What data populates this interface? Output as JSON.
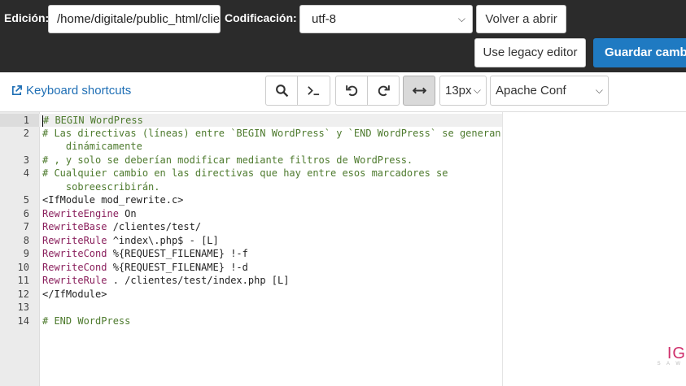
{
  "header": {
    "edit_label": "Edición:",
    "path_value": "/home/digitale/public_html/clientes/test/.htaccess",
    "encoding_label": "Codificación:",
    "encoding_value": "utf-8",
    "reopen_label": "Volver a abrir",
    "legacy_label": "Use legacy editor",
    "save_label": "Guardar cambios"
  },
  "toolbar": {
    "shortcuts_label": "Keyboard shortcuts",
    "font_size": "13px",
    "mode": "Apache Conf"
  },
  "editor": {
    "lines": [
      {
        "n": "1",
        "t": "# BEGIN WordPress"
      },
      {
        "n": "2",
        "t": "# Las directivas (líneas) entre `BEGIN WordPress` y `END WordPress` se generan",
        "t2": "    dinámicamente"
      },
      {
        "n": "3",
        "t": "# , y solo se deberían modificar mediante filtros de WordPress."
      },
      {
        "n": "4",
        "t": "# Cualquier cambio en las directivas que hay entre esos marcadores se",
        "t2": "    sobreescribirán."
      },
      {
        "n": "5",
        "t": "<IfModule mod_rewrite.c>"
      },
      {
        "n": "6",
        "k": "RewriteEngine",
        "r": " On"
      },
      {
        "n": "7",
        "k": "RewriteBase",
        "r": " /clientes/test/"
      },
      {
        "n": "8",
        "k": "RewriteRule",
        "r": " ^index\\.php$ - [L]"
      },
      {
        "n": "9",
        "k": "RewriteCond",
        "r": " %{REQUEST_FILENAME} !-f"
      },
      {
        "n": "10",
        "k": "RewriteCond",
        "r": " %{REQUEST_FILENAME} !-d"
      },
      {
        "n": "11",
        "k": "RewriteRule",
        "r": " . /clientes/test/index.php [L]"
      },
      {
        "n": "12",
        "t": "</IfModule>"
      },
      {
        "n": "13",
        "t": ""
      },
      {
        "n": "14",
        "t": "# END WordPress"
      }
    ]
  },
  "watermark": {
    "text": "IG",
    "sub": "S A W"
  },
  "colors": {
    "topbar": "#2b2b2b",
    "primary": "#1f7ac2",
    "comment": "#4d7a2d",
    "keyword": "#8a1f5c"
  }
}
